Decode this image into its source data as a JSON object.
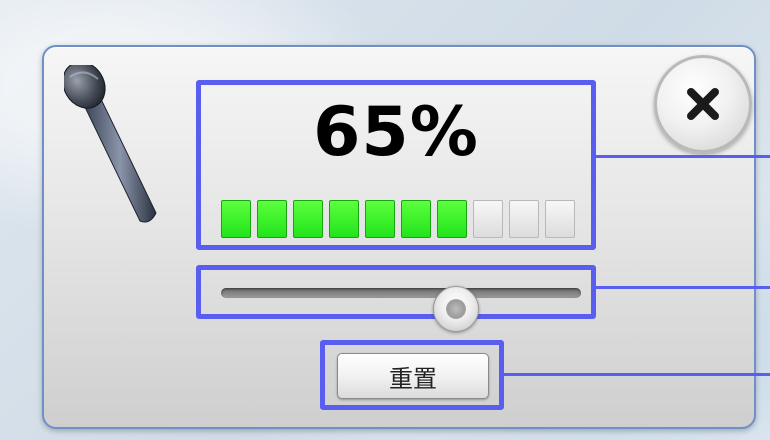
{
  "dialog": {
    "title": "",
    "close_icon": "close-x-icon",
    "mic_icon": "microphone-icon"
  },
  "level": {
    "percent_text": "65%",
    "value": 0.65,
    "segments_total": 10,
    "segments_lit": 7,
    "lit_color": "#33ff2a",
    "unlit_color": "#e6e6e6"
  },
  "slider": {
    "value": 0.65
  },
  "reset": {
    "label": "重置"
  },
  "colors": {
    "highlight": "#5a5ef0",
    "panel_border": "#6f8fc9"
  }
}
